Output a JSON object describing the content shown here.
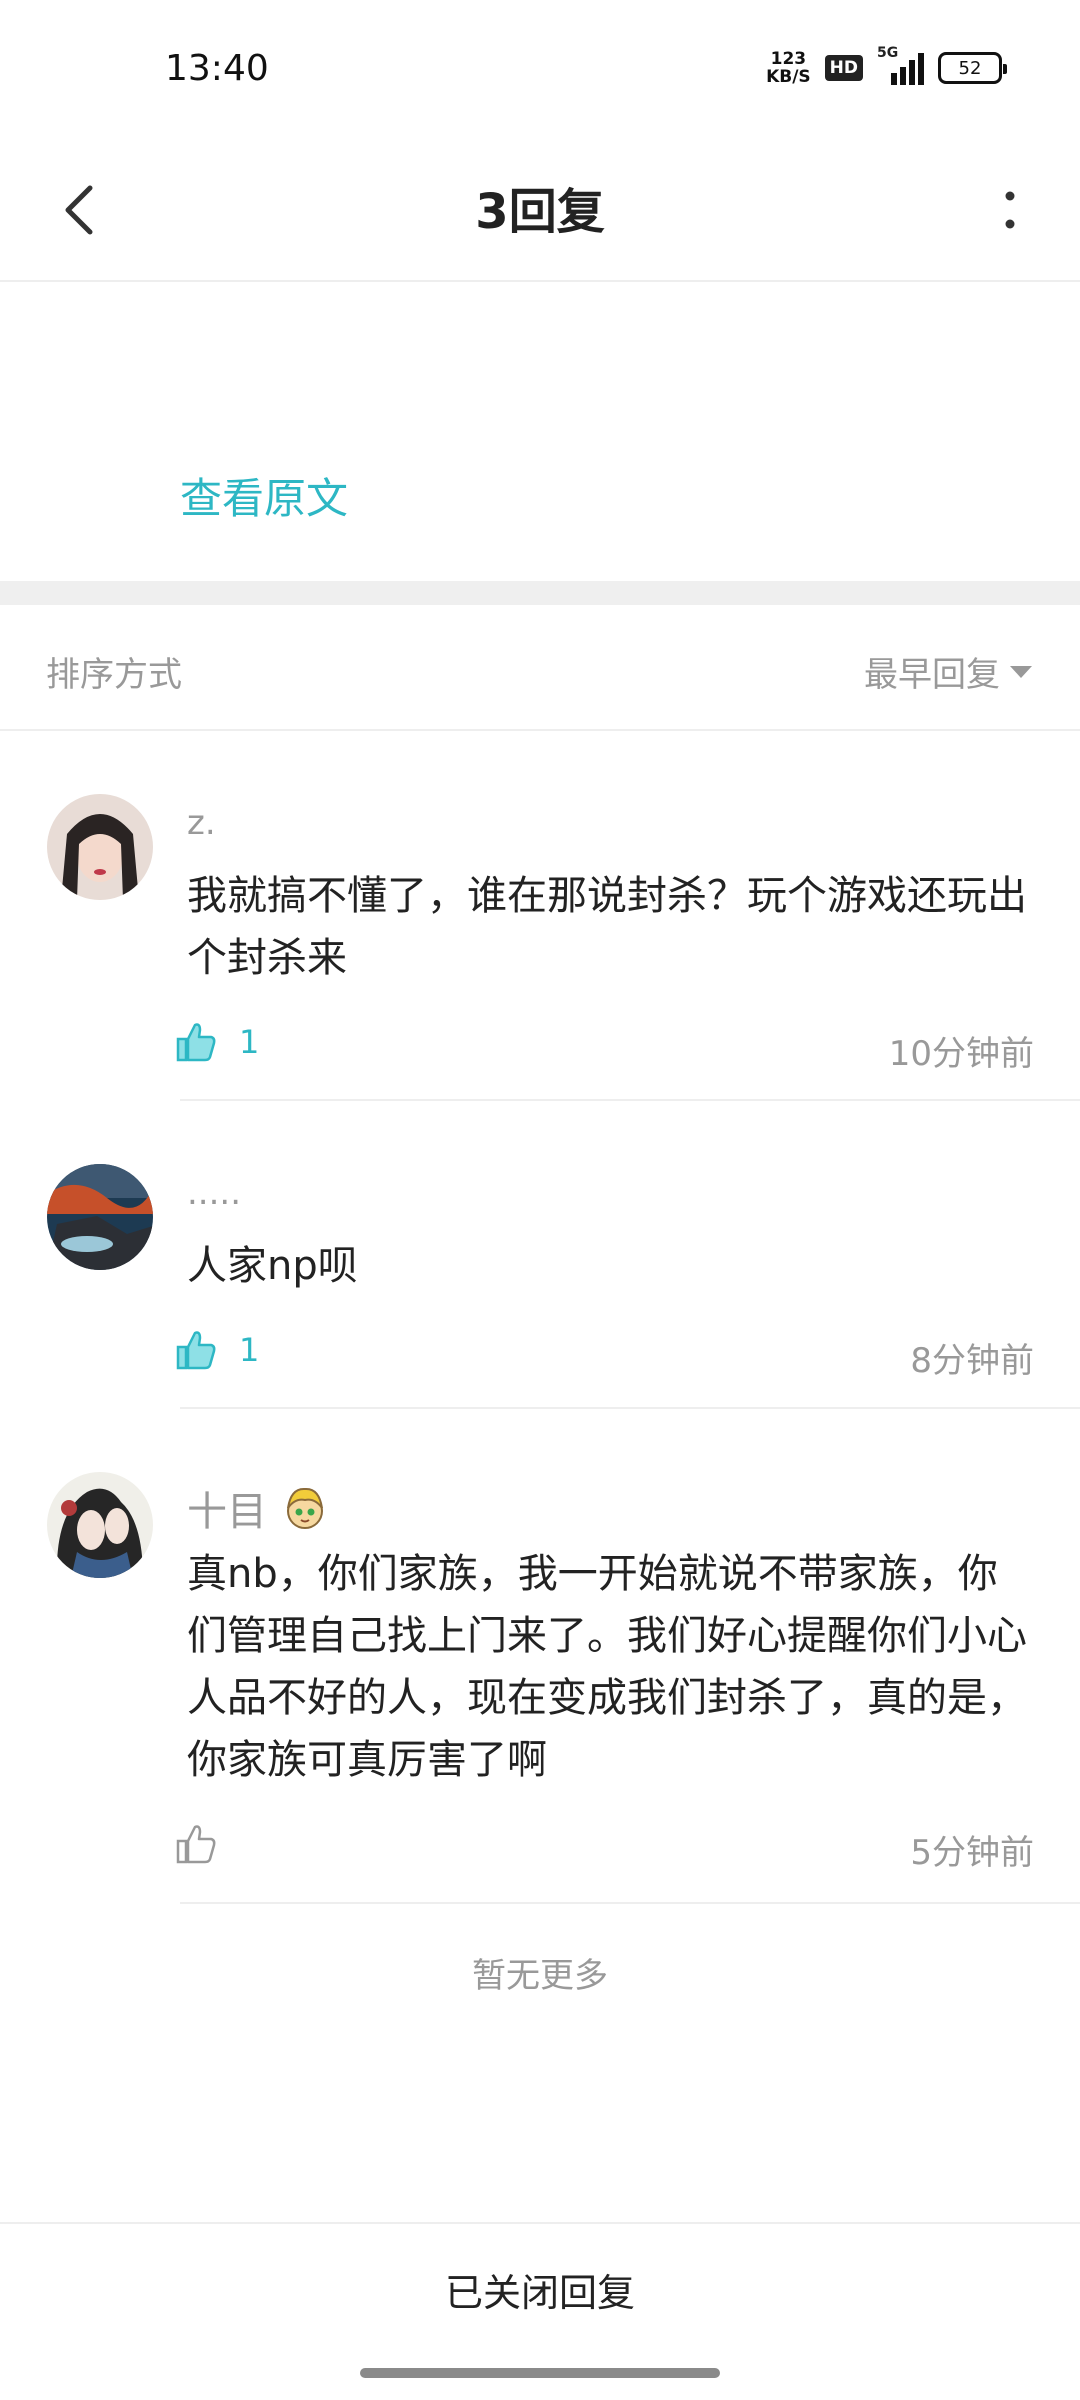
{
  "status_bar": {
    "time": "13:40",
    "net_speed_value": "123",
    "net_speed_unit": "KB/S",
    "hd": "HD",
    "network": "5G",
    "battery": "52"
  },
  "header": {
    "title": "3回复"
  },
  "post": {
    "view_original": "查看原文"
  },
  "sort": {
    "label": "排序方式",
    "selected": "最早回复"
  },
  "comments": [
    {
      "username": "z.",
      "text": "我就搞不懂了，谁在那说封杀？玩个游戏还玩出个封杀来",
      "likes": "1",
      "liked": true,
      "time": "10分钟前"
    },
    {
      "username": ".....",
      "text": "人家np呗",
      "likes": "1",
      "liked": true,
      "time": "8分钟前"
    },
    {
      "username": "十目",
      "text": "真nb，你们家族，我一开始就说不带家族，你们管理自己找上门来了。我们好心提醒你们小心人品不好的人，现在变成我们封杀了，真的是，你家族可真厉害了啊",
      "likes": "",
      "liked": false,
      "time": "5分钟前"
    }
  ],
  "list_end": "暂无更多",
  "footer": {
    "replies_closed": "已关闭回复"
  },
  "colors": {
    "accent": "#2db7c4",
    "muted": "#999999"
  }
}
